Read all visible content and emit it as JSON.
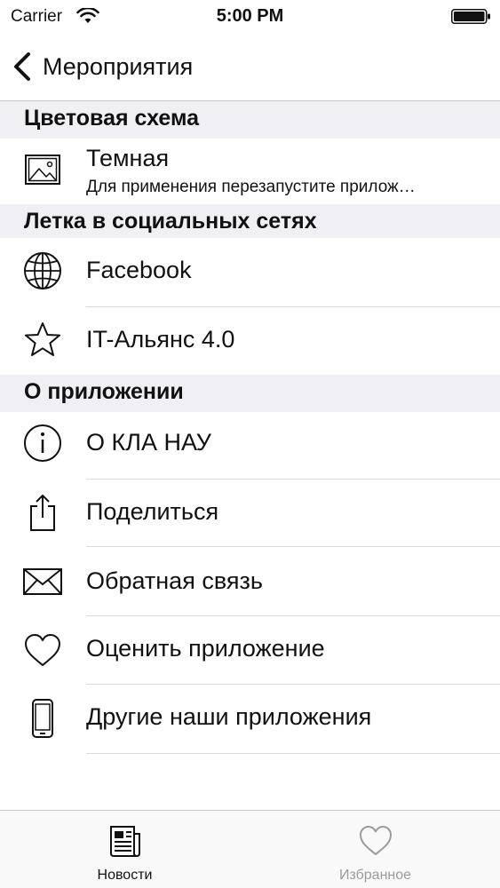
{
  "status_bar": {
    "carrier": "Carrier",
    "time": "5:00 PM"
  },
  "nav": {
    "back_label": "Мероприятия"
  },
  "sections": {
    "color_scheme": {
      "header": "Цветовая схема",
      "row": {
        "label": "Темная",
        "subtitle": "Для применения перезапустите прилож…",
        "icon": "image-icon"
      }
    },
    "social": {
      "header": "Летка в социальных сетях",
      "rows": [
        {
          "label": "Facebook",
          "icon": "globe-icon"
        },
        {
          "label": "IT-Альянс 4.0",
          "icon": "star-icon"
        }
      ]
    },
    "about": {
      "header": "О приложении",
      "rows": [
        {
          "label": "О КЛА НАУ",
          "icon": "info-icon"
        },
        {
          "label": "Поделиться",
          "icon": "share-icon"
        },
        {
          "label": "Обратная связь",
          "icon": "envelope-icon"
        },
        {
          "label": "Оценить приложение",
          "icon": "heart-icon"
        },
        {
          "label": "Другие наши приложения",
          "icon": "phone-icon"
        }
      ]
    }
  },
  "tab_bar": {
    "tabs": [
      {
        "label": "Новости",
        "icon": "newspaper-icon",
        "active": true
      },
      {
        "label": "Избранное",
        "icon": "heart-icon",
        "active": false
      }
    ],
    "active_color": "#111111",
    "inactive_color": "#9b9b9b"
  }
}
